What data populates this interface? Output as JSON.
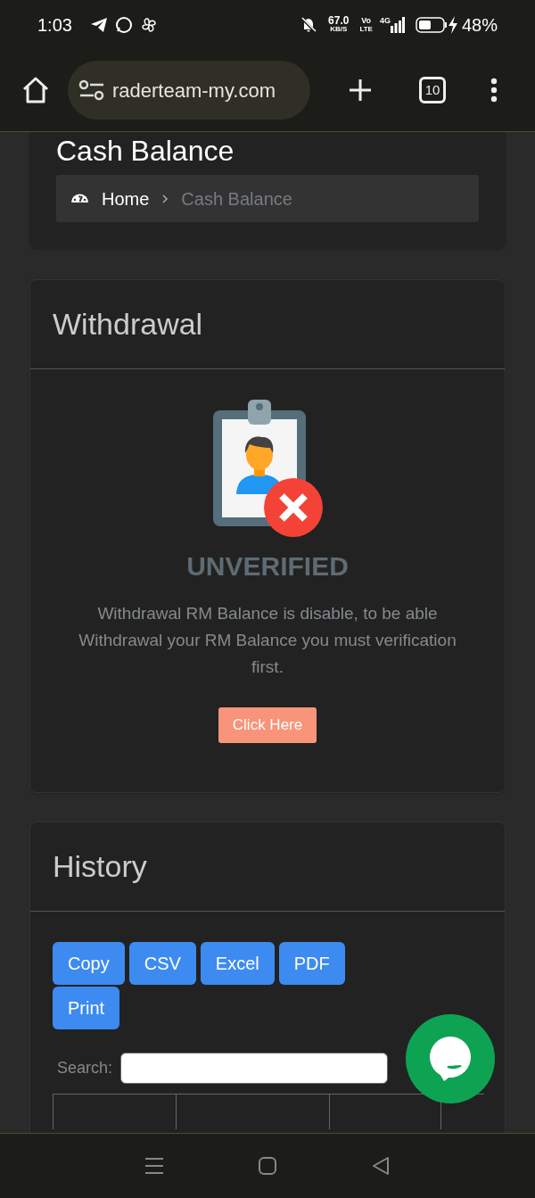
{
  "status_bar": {
    "time": "1:03",
    "speed": "67.0",
    "speed_unit": "KB/S",
    "volte_top": "Vo",
    "volte_bottom": "LTE",
    "network": "4G",
    "battery": "48%"
  },
  "browser": {
    "url": "raderteam-my.com",
    "tab_count": "10"
  },
  "page_title": "Cash Balance",
  "breadcrumb": [
    {
      "label": "Home",
      "current": false
    },
    {
      "label": "Cash Balance",
      "current": true
    }
  ],
  "withdrawal": {
    "title": "Withdrawal",
    "status": "UNVERIFIED",
    "message": "Withdrawal RM Balance is disable, to be able Withdrawal your RM Balance you must verification first.",
    "button": "Click Here"
  },
  "history": {
    "title": "History",
    "export_buttons": [
      "Copy",
      "CSV",
      "Excel",
      "PDF",
      "Print"
    ],
    "search_label": "Search:"
  }
}
